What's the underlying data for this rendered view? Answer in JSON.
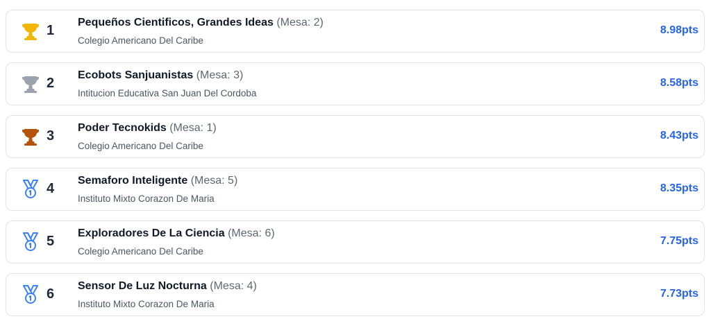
{
  "ranking": [
    {
      "rank": "1",
      "icon": "trophy-gold-icon",
      "icon_color": "#f2b705",
      "name": "Pequeños Cientificos, Grandes Ideas",
      "mesa": "(Mesa: 2)",
      "school": "Colegio Americano Del Caribe",
      "score": "8.98pts"
    },
    {
      "rank": "2",
      "icon": "trophy-silver-icon",
      "icon_color": "#9ca3af",
      "name": "Ecobots Sanjuanistas",
      "mesa": "(Mesa: 3)",
      "school": "Intitucion Educativa San Juan Del Cordoba",
      "score": "8.58pts"
    },
    {
      "rank": "3",
      "icon": "trophy-bronze-icon",
      "icon_color": "#b45309",
      "name": "Poder Tecnokids",
      "mesa": "(Mesa: 1)",
      "school": "Colegio Americano Del Caribe",
      "score": "8.43pts"
    },
    {
      "rank": "4",
      "icon": "medal-icon",
      "icon_color": "#3b82f6",
      "name": "Semaforo Inteligente",
      "mesa": "(Mesa: 5)",
      "school": "Instituto Mixto Corazon De Maria",
      "score": "8.35pts"
    },
    {
      "rank": "5",
      "icon": "medal-icon",
      "icon_color": "#3b82f6",
      "name": "Exploradores De La Ciencia",
      "mesa": "(Mesa: 6)",
      "school": "Colegio Americano Del Caribe",
      "score": "7.75pts"
    },
    {
      "rank": "6",
      "icon": "medal-icon",
      "icon_color": "#3b82f6",
      "name": "Sensor De Luz Nocturna",
      "mesa": "(Mesa: 4)",
      "school": "Instituto Mixto Corazon De Maria",
      "score": "7.73pts"
    }
  ]
}
